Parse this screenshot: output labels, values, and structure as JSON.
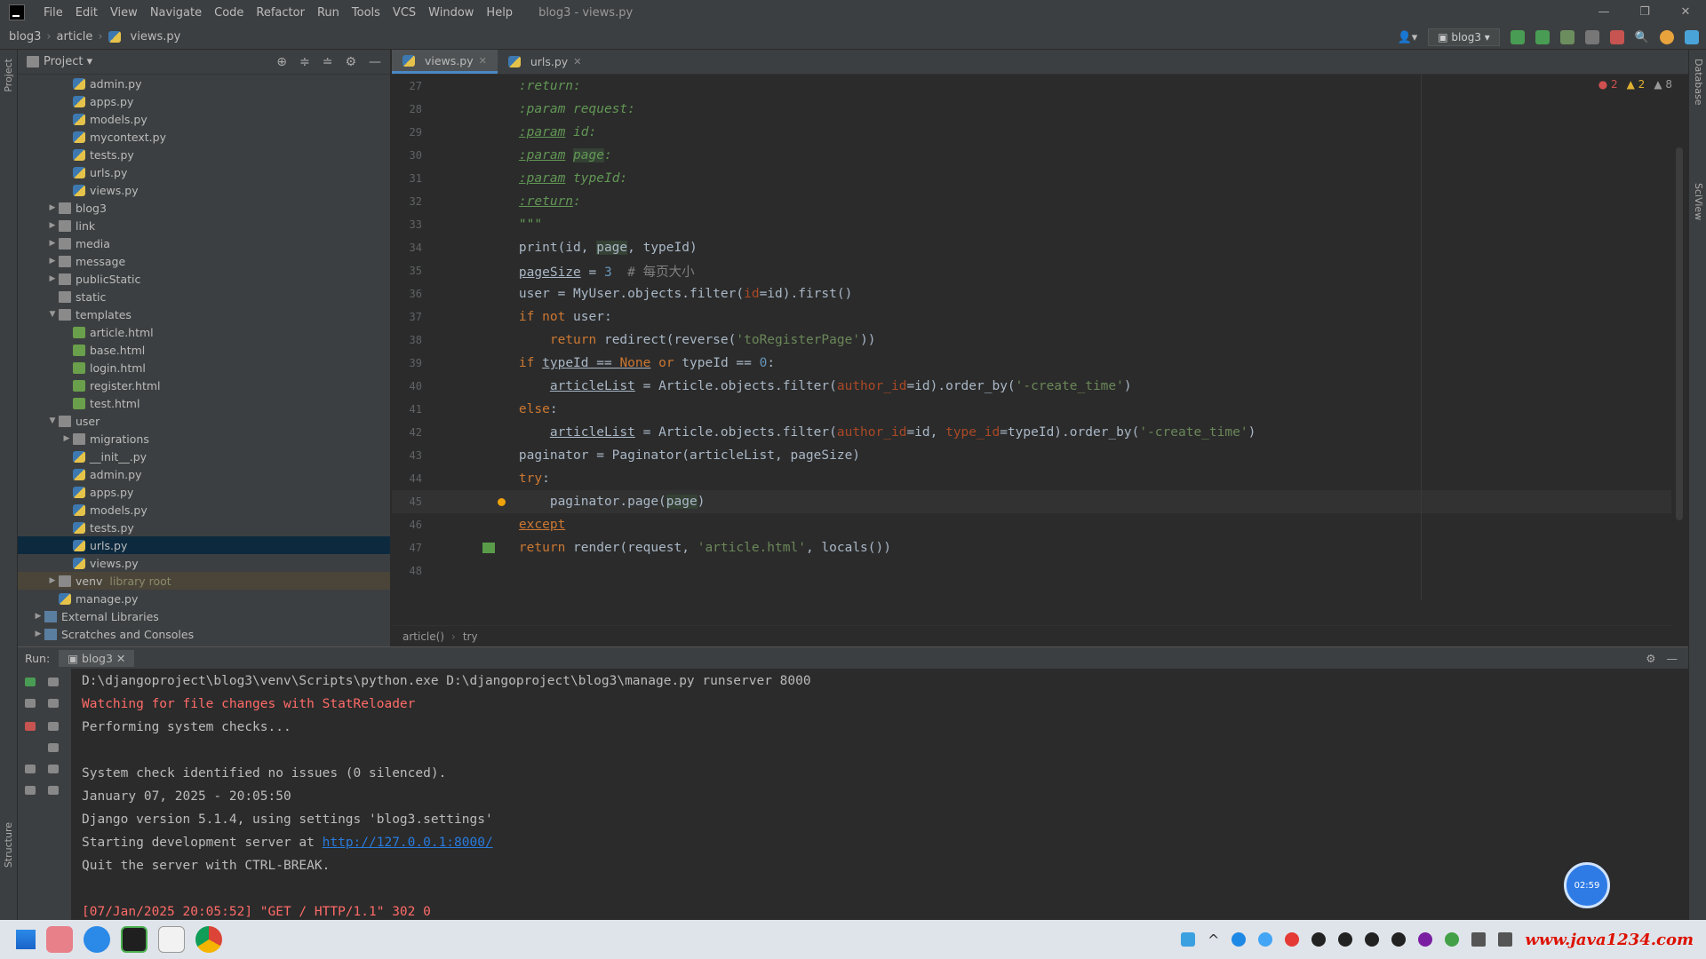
{
  "menubar": {
    "items": [
      "File",
      "Edit",
      "View",
      "Navigate",
      "Code",
      "Refactor",
      "Run",
      "Tools",
      "VCS",
      "Window",
      "Help"
    ],
    "title": "blog3 - views.py"
  },
  "navbar": {
    "crumbs": [
      "blog3",
      "article",
      "views.py"
    ],
    "run_config": "blog3"
  },
  "project": {
    "title": "Project",
    "tree": [
      {
        "name": "admin.py",
        "type": "py",
        "depth": 3
      },
      {
        "name": "apps.py",
        "type": "py",
        "depth": 3
      },
      {
        "name": "models.py",
        "type": "py",
        "depth": 3
      },
      {
        "name": "mycontext.py",
        "type": "py",
        "depth": 3
      },
      {
        "name": "tests.py",
        "type": "py",
        "depth": 3
      },
      {
        "name": "urls.py",
        "type": "py",
        "depth": 3
      },
      {
        "name": "views.py",
        "type": "py",
        "depth": 3
      },
      {
        "name": "blog3",
        "type": "folder",
        "depth": 2,
        "arrow": ">"
      },
      {
        "name": "link",
        "type": "folder",
        "depth": 2,
        "arrow": ">"
      },
      {
        "name": "media",
        "type": "folder",
        "depth": 2,
        "arrow": ">"
      },
      {
        "name": "message",
        "type": "folder",
        "depth": 2,
        "arrow": ">"
      },
      {
        "name": "publicStatic",
        "type": "folder",
        "depth": 2,
        "arrow": ">"
      },
      {
        "name": "static",
        "type": "folder",
        "depth": 2,
        "arrow": ""
      },
      {
        "name": "templates",
        "type": "folder",
        "depth": 2,
        "arrow": "v"
      },
      {
        "name": "article.html",
        "type": "html",
        "depth": 3
      },
      {
        "name": "base.html",
        "type": "html",
        "depth": 3
      },
      {
        "name": "login.html",
        "type": "html",
        "depth": 3
      },
      {
        "name": "register.html",
        "type": "html",
        "depth": 3
      },
      {
        "name": "test.html",
        "type": "html",
        "depth": 3
      },
      {
        "name": "user",
        "type": "folder",
        "depth": 2,
        "arrow": "v"
      },
      {
        "name": "migrations",
        "type": "folder",
        "depth": 3,
        "arrow": ">"
      },
      {
        "name": "__init__.py",
        "type": "py",
        "depth": 3
      },
      {
        "name": "admin.py",
        "type": "py",
        "depth": 3
      },
      {
        "name": "apps.py",
        "type": "py",
        "depth": 3
      },
      {
        "name": "models.py",
        "type": "py",
        "depth": 3
      },
      {
        "name": "tests.py",
        "type": "py",
        "depth": 3
      },
      {
        "name": "urls.py",
        "type": "py",
        "depth": 3,
        "selected": true
      },
      {
        "name": "views.py",
        "type": "py",
        "depth": 3
      },
      {
        "name": "venv",
        "type": "folder",
        "depth": 2,
        "arrow": ">",
        "note": "library root",
        "venv": true
      },
      {
        "name": "manage.py",
        "type": "py",
        "depth": 2
      },
      {
        "name": "External Libraries",
        "type": "lib",
        "depth": 1,
        "arrow": ">"
      },
      {
        "name": "Scratches and Consoles",
        "type": "lib",
        "depth": 1,
        "arrow": ">"
      }
    ]
  },
  "editor": {
    "tabs": [
      {
        "label": "views.py",
        "active": true
      },
      {
        "label": "urls.py",
        "active": false
      }
    ],
    "inspections": {
      "errors": "2",
      "warnings": "2",
      "weak": "8"
    },
    "breadcrumb": [
      "article()",
      "try"
    ],
    "lines": [
      {
        "n": "27",
        "html": "    <span class=\"doc\">:return:</span>"
      },
      {
        "n": "28",
        "html": "    <span class=\"doc\">:param request:</span>"
      },
      {
        "n": "29",
        "html": "    <span class=\"doc\"><span class=\"und\">:param</span> id:</span>"
      },
      {
        "n": "30",
        "html": "    <span class=\"doc\"><span class=\"und\">:param</span> <span class=\"hl\">page</span>:</span>"
      },
      {
        "n": "31",
        "html": "    <span class=\"doc\"><span class=\"und\">:param</span> typeId:</span>"
      },
      {
        "n": "32",
        "html": "    <span class=\"doc\"><span class=\"und\">:return</span>:</span>"
      },
      {
        "n": "33",
        "html": "    <span class=\"doc\">\"\"\"</span>"
      },
      {
        "n": "34",
        "html": "    print(id, <span class=\"hl\">page</span>, typeId)"
      },
      {
        "n": "35",
        "html": "    <span class=\"und\">pageSize</span> = <span class=\"nm\">3</span>  <span class=\"cm\"># 每页大小</span>"
      },
      {
        "n": "36",
        "html": "    user = MyUser.objects.filter(<span class=\"par\">id</span>=id).first()"
      },
      {
        "n": "37",
        "html": "    <span class=\"kw\">if not</span> user:"
      },
      {
        "n": "38",
        "html": "        <span class=\"kw\">return</span> redirect(reverse(<span class=\"st\">'toRegisterPage'</span>))"
      },
      {
        "n": "39",
        "html": "    <span class=\"kw\">if</span> <span class=\"und\">typeId == <span class=\"kw\">None</span></span> <span class=\"kw\">or</span> typeId == <span class=\"nm\">0</span>:"
      },
      {
        "n": "40",
        "html": "        <span class=\"und\">articleList</span> = Article.objects.filter(<span class=\"par\">author_id</span>=id).order_by(<span class=\"st\">'-create_time'</span>)"
      },
      {
        "n": "41",
        "html": "    <span class=\"kw\">else</span>:"
      },
      {
        "n": "42",
        "html": "        <span class=\"und\">articleList</span> = Article.objects.filter(<span class=\"par\">author_id</span>=id, <span class=\"par\">type_id</span>=typeId).order_by(<span class=\"st\">'-create_time'</span>)"
      },
      {
        "n": "43",
        "html": "    paginator = Paginator(articleList, pageSize)"
      },
      {
        "n": "44",
        "html": "    <span class=\"kw\">try</span>:"
      },
      {
        "n": "45",
        "html": "        paginator.page(<span class=\"hl\">page</span>)",
        "current": true
      },
      {
        "n": "46",
        "html": "    <span class=\"kw und\">except</span>"
      },
      {
        "n": "47",
        "html": "    <span class=\"kw\">return</span> render(request, <span class=\"st\">'article.html'</span>, locals())"
      },
      {
        "n": "48",
        "html": ""
      }
    ]
  },
  "run": {
    "label": "Run:",
    "tab": "blog3",
    "lines": [
      {
        "text": "D:\\djangoproject\\blog3\\venv\\Scripts\\python.exe D:\\djangoproject\\blog3\\manage.py runserver 8000",
        "kind": "normal"
      },
      {
        "text": "Watching for file changes with StatReloader",
        "kind": "err"
      },
      {
        "text": "Performing system checks...",
        "kind": "normal"
      },
      {
        "text": "",
        "kind": "normal"
      },
      {
        "text": "System check identified no issues (0 silenced).",
        "kind": "normal"
      },
      {
        "text": "January 07, 2025 - 20:05:50",
        "kind": "normal"
      },
      {
        "text": "Django version 5.1.4, using settings 'blog3.settings'",
        "kind": "normal"
      },
      {
        "text": "Starting development server at ",
        "kind": "link",
        "link": "http://127.0.0.1:8000/"
      },
      {
        "text": "Quit the server with CTRL-BREAK.",
        "kind": "normal"
      },
      {
        "text": "",
        "kind": "normal"
      },
      {
        "text": "[07/Jan/2025 20:05:52] \"GET / HTTP/1.1\" 302 0",
        "kind": "err"
      }
    ],
    "recorder_time": "02:59"
  },
  "taskbar": {
    "watermark": "www.java1234.com"
  },
  "side": {
    "left_top": "Project",
    "left_bottom": "Structure",
    "right_top": "Database",
    "right_mid": "SciView"
  },
  "colors": {
    "accent": "#4a88c7",
    "error": "#ff6b68",
    "string": "#6a8759",
    "keyword": "#cc7832"
  }
}
